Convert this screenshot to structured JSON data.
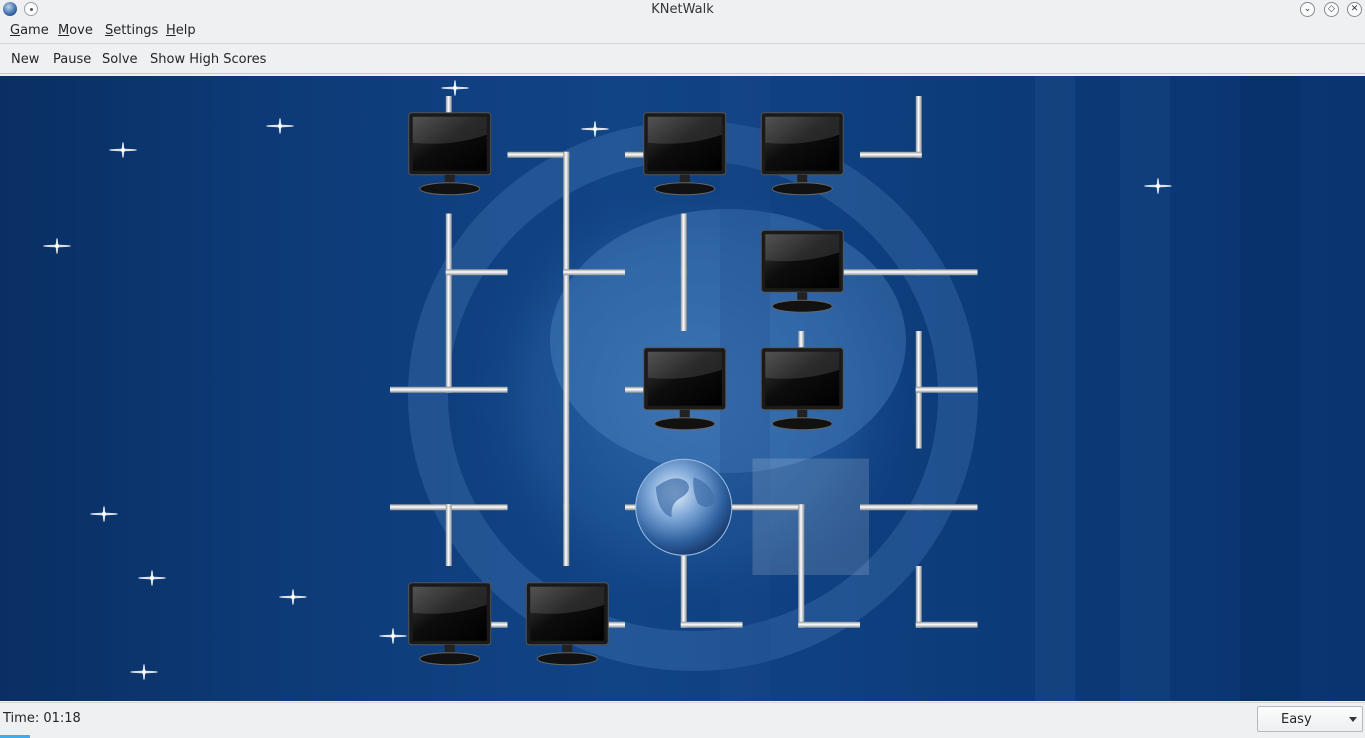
{
  "window": {
    "title": "KNetWalk"
  },
  "menu": {
    "items": [
      "Game",
      "Move",
      "Settings",
      "Help"
    ]
  },
  "toolbar": {
    "new_label": "New",
    "pause_label": "Pause",
    "solve_label": "Solve",
    "highscores_label": "Show High Scores"
  },
  "status": {
    "time_text": "Time: 01:18"
  },
  "difficulty": {
    "selected": "Easy"
  },
  "board": {
    "grid": {
      "cols": 5,
      "rows": 5
    },
    "cells": [
      {
        "row": 0,
        "col": 0,
        "type": "computer",
        "connections": [
          "up"
        ]
      },
      {
        "row": 0,
        "col": 1,
        "type": "pipe-corner",
        "connections": [
          "left",
          "down"
        ]
      },
      {
        "row": 0,
        "col": 2,
        "type": "computer",
        "connections": [
          "left"
        ]
      },
      {
        "row": 0,
        "col": 3,
        "type": "computer",
        "connections": []
      },
      {
        "row": 0,
        "col": 4,
        "type": "pipe-corner",
        "connections": [
          "up",
          "left"
        ]
      },
      {
        "row": 1,
        "col": 0,
        "type": "pipe-tee",
        "connections": [
          "up",
          "down",
          "right"
        ]
      },
      {
        "row": 1,
        "col": 1,
        "type": "pipe-tee",
        "connections": [
          "up",
          "down",
          "right"
        ]
      },
      {
        "row": 1,
        "col": 2,
        "type": "pipe-straight",
        "connections": [
          "up",
          "down"
        ]
      },
      {
        "row": 1,
        "col": 3,
        "type": "computer",
        "connections": [
          "right"
        ]
      },
      {
        "row": 1,
        "col": 4,
        "type": "pipe-straight",
        "connections": [
          "left",
          "right"
        ]
      },
      {
        "row": 2,
        "col": 0,
        "type": "pipe-corner",
        "connections": [
          "up",
          "left",
          "right"
        ]
      },
      {
        "row": 2,
        "col": 1,
        "type": "pipe-straight",
        "connections": [
          "up",
          "down"
        ]
      },
      {
        "row": 2,
        "col": 2,
        "type": "computer",
        "connections": [
          "left"
        ]
      },
      {
        "row": 2,
        "col": 3,
        "type": "computer",
        "connections": [
          "up"
        ]
      },
      {
        "row": 2,
        "col": 4,
        "type": "pipe-tee",
        "connections": [
          "up",
          "down",
          "right"
        ]
      },
      {
        "row": 3,
        "col": 0,
        "type": "pipe-tee",
        "connections": [
          "left",
          "right",
          "down"
        ]
      },
      {
        "row": 3,
        "col": 1,
        "type": "pipe-straight",
        "connections": [
          "up",
          "down"
        ]
      },
      {
        "row": 3,
        "col": 2,
        "type": "server",
        "connections": [
          "left",
          "down",
          "right"
        ]
      },
      {
        "row": 3,
        "col": 3,
        "type": "pipe-corner",
        "connections": [
          "left",
          "down"
        ],
        "highlighted": true
      },
      {
        "row": 3,
        "col": 4,
        "type": "pipe-straight",
        "connections": [
          "left",
          "right"
        ]
      },
      {
        "row": 4,
        "col": 0,
        "type": "computer",
        "connections": [
          "right"
        ]
      },
      {
        "row": 4,
        "col": 1,
        "type": "computer",
        "connections": [
          "right"
        ]
      },
      {
        "row": 4,
        "col": 2,
        "type": "pipe-corner",
        "connections": [
          "up",
          "right"
        ]
      },
      {
        "row": 4,
        "col": 3,
        "type": "pipe-corner",
        "connections": [
          "up",
          "right"
        ]
      },
      {
        "row": 4,
        "col": 4,
        "type": "pipe-corner",
        "connections": [
          "up",
          "right"
        ]
      }
    ]
  },
  "icons": {
    "app": "knetwalk-globe-icon",
    "window_menu": "window-menu-icon",
    "minimize": "minimize-icon",
    "maximize": "maximize-icon",
    "close": "close-icon"
  }
}
